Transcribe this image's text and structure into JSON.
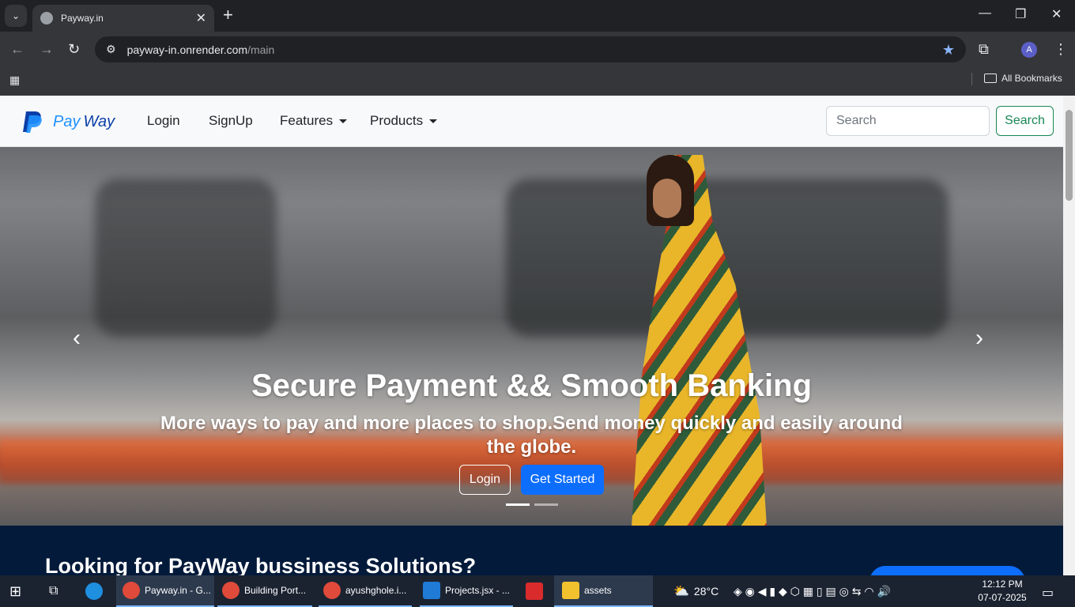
{
  "browser": {
    "tab_title": "Payway.in",
    "url_host": "payway-in.onrender.com",
    "url_path": "/main",
    "bookmarks_label": "All Bookmarks",
    "profile_initial": "A"
  },
  "navbar": {
    "brand_pay": "Pay",
    "brand_way": "Way",
    "links": [
      "Login",
      "SignUp",
      "Features",
      "Products"
    ],
    "search_placeholder": "Search",
    "search_button": "Search"
  },
  "hero": {
    "title": "Secure Payment && Smooth Banking",
    "subtitle": "More ways to pay and more places to shop.Send money quickly and easily around the globe.",
    "login_button": "Login",
    "get_started_button": "Get Started",
    "prev_arrow": "‹",
    "next_arrow": "›"
  },
  "section": {
    "heading": "Looking for PayWay bussiness Solutions?"
  },
  "taskbar": {
    "items": [
      "Payway.in - G...",
      "Building Port...",
      "ayushghole.i...",
      "Projects.jsx - ...",
      "assets"
    ],
    "weather": "28°C",
    "time": "12:12 PM",
    "date": "07-07-2025"
  }
}
